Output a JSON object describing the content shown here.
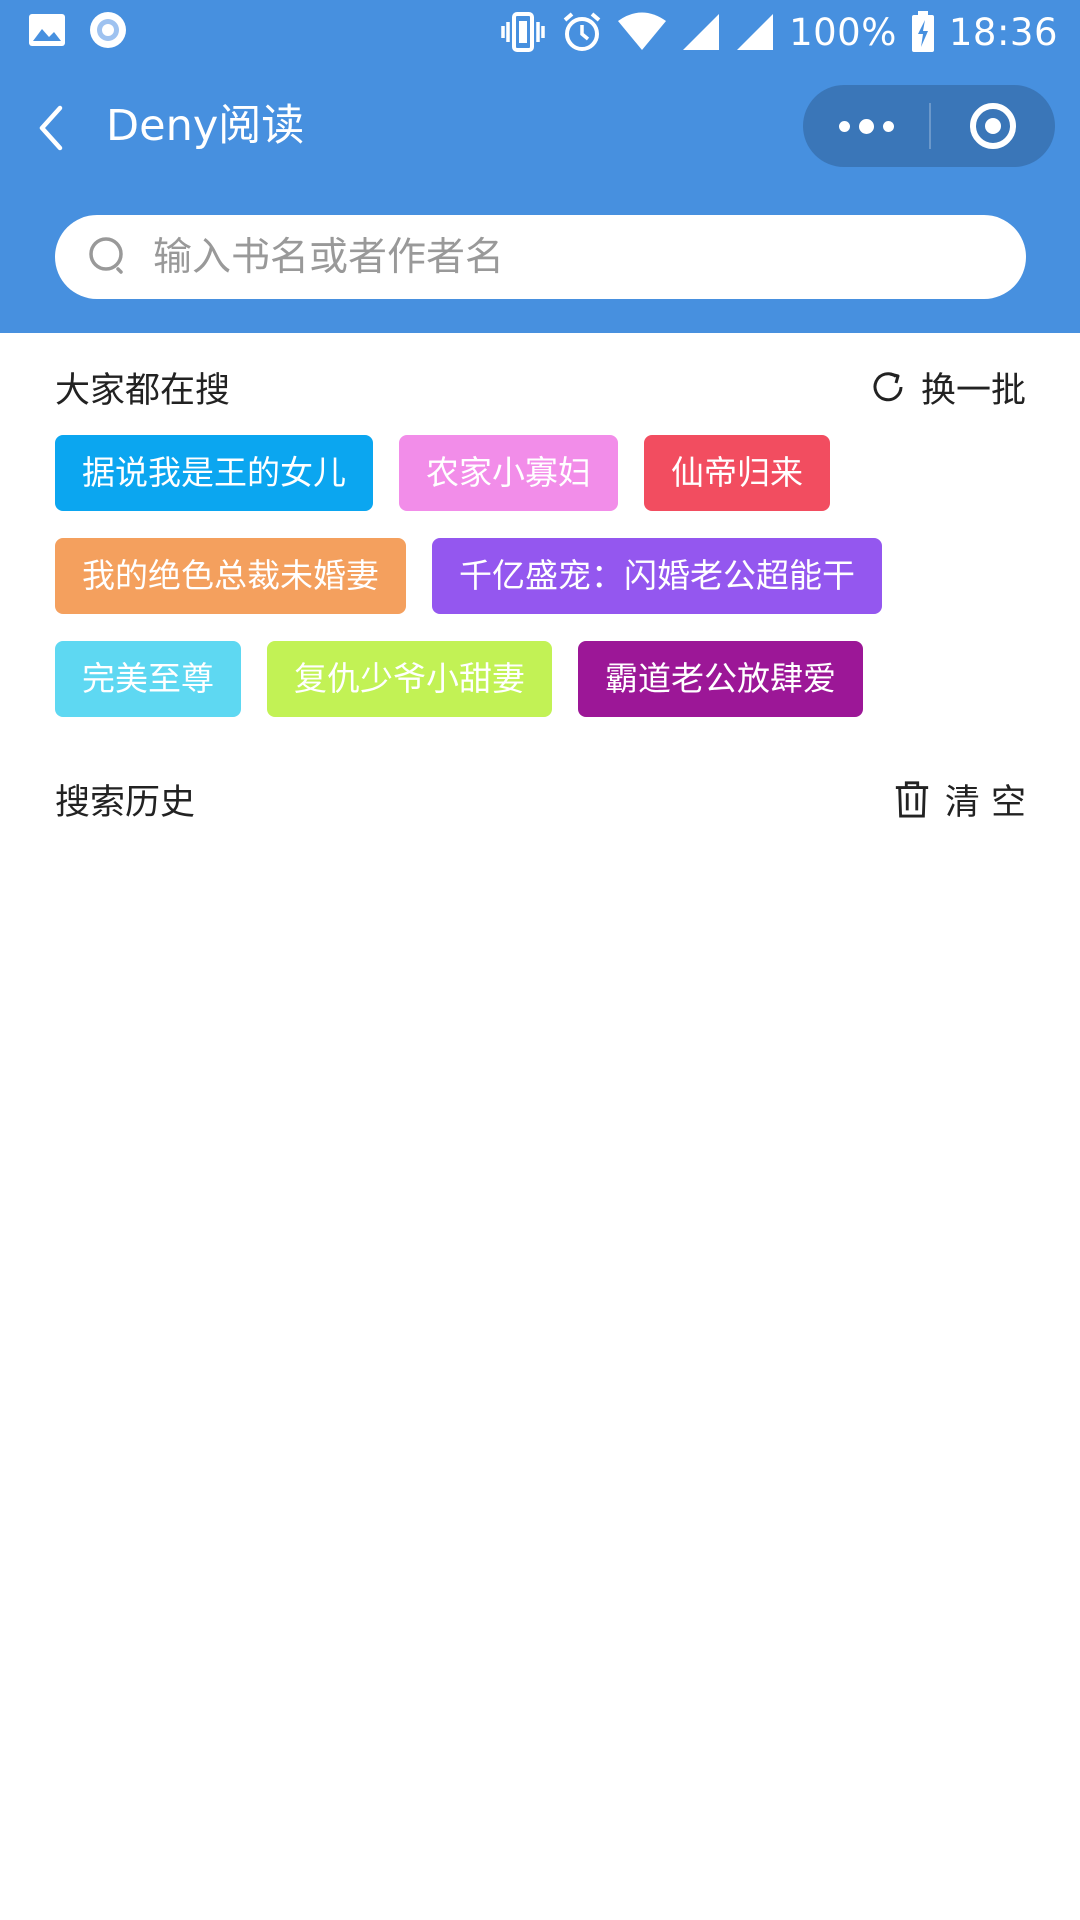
{
  "status_bar": {
    "battery": "100%",
    "time": "18:36"
  },
  "nav": {
    "title": "Deny阅读"
  },
  "search": {
    "placeholder": "输入书名或者作者名",
    "value": ""
  },
  "hot": {
    "title": "大家都在搜",
    "refresh_label": "换一批",
    "rows": [
      [
        {
          "label": "据说我是王的女儿",
          "color": "#0ba6f0"
        },
        {
          "label": "农家小寡妇",
          "color": "#f28de9"
        },
        {
          "label": "仙帝归来",
          "color": "#f24d60"
        }
      ],
      [
        {
          "label": "我的绝色总裁未婚妻",
          "color": "#f4a05e"
        },
        {
          "label": "千亿盛宠：闪婚老公超能干",
          "color": "#9457ef"
        }
      ],
      [
        {
          "label": "完美至尊",
          "color": "#5ed8f2"
        },
        {
          "label": "复仇少爷小甜妻",
          "color": "#c2f255"
        },
        {
          "label": "霸道老公放肆爱",
          "color": "#9c1797"
        }
      ]
    ]
  },
  "history": {
    "title": "搜索历史",
    "clear_label": "清 空"
  },
  "colors": {
    "header_bg": "#4790df",
    "capsule_bg": "#3a76b8"
  }
}
